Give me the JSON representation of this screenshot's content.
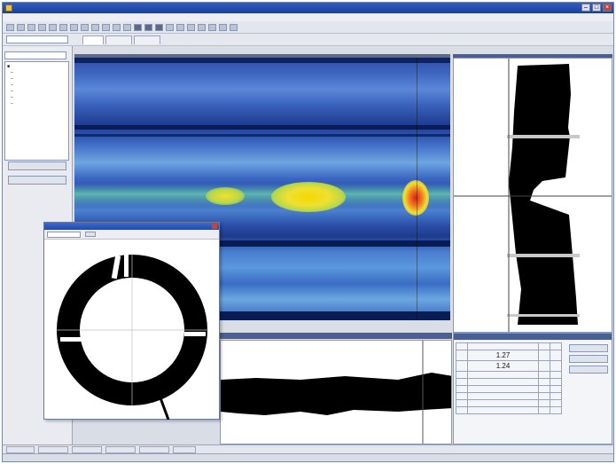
{
  "window": {
    "title": ""
  },
  "menu": [],
  "tabs": [],
  "sidebar": {
    "buttons": []
  },
  "stats": {
    "rows": [
      [
        "",
        "",
        "",
        ""
      ],
      [
        "1.27",
        "",
        "",
        ""
      ],
      [
        "1.24",
        "",
        "",
        ""
      ]
    ]
  },
  "colors": {
    "accent": "#2349a8",
    "heat_low": "#1d3a8e",
    "heat_high": "#e02010",
    "plot_ink": "#000000"
  }
}
